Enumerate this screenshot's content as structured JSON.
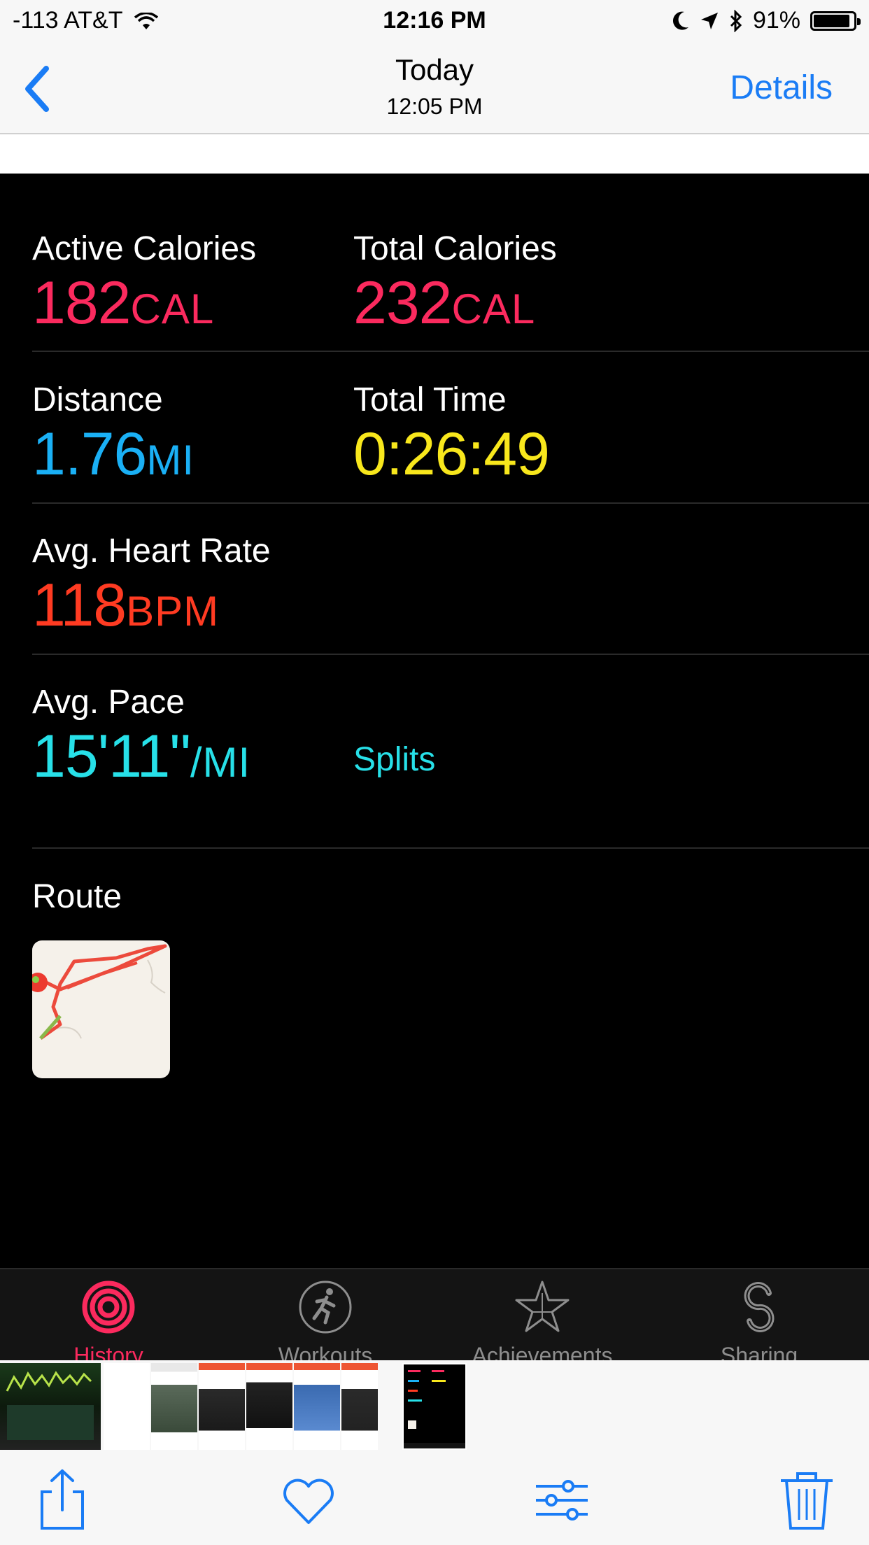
{
  "status_bar": {
    "carrier": "-113 AT&T",
    "time": "12:16 PM",
    "battery_percent": "91%",
    "battery_level": 0.91,
    "icons": [
      "wifi-icon",
      "moon-icon",
      "location-arrow-icon",
      "bluetooth-icon",
      "battery-icon"
    ]
  },
  "nav": {
    "title": "Today",
    "subtitle": "12:05 PM",
    "details_label": "Details"
  },
  "metrics": {
    "active_calories": {
      "label": "Active Calories",
      "value": "182",
      "unit": "CAL"
    },
    "total_calories": {
      "label": "Total Calories",
      "value": "232",
      "unit": "CAL"
    },
    "distance": {
      "label": "Distance",
      "value": "1.76",
      "unit": "MI"
    },
    "total_time": {
      "label": "Total Time",
      "value": "0:26:49"
    },
    "avg_heart_rate": {
      "label": "Avg. Heart Rate",
      "value": "118",
      "unit": "BPM"
    },
    "avg_pace": {
      "label": "Avg. Pace",
      "value": "15'11\"",
      "unit": "/MI"
    },
    "splits_label": "Splits"
  },
  "route": {
    "label": "Route"
  },
  "tabs": [
    {
      "label": "History",
      "icon": "activity-rings-icon",
      "active": true
    },
    {
      "label": "Workouts",
      "icon": "running-figure-icon",
      "active": false
    },
    {
      "label": "Achievements",
      "icon": "star-icon",
      "active": false
    },
    {
      "label": "Sharing",
      "icon": "sharing-icon",
      "active": false
    }
  ],
  "toolbar": {
    "icons": [
      "share-icon",
      "heart-icon",
      "adjust-icon",
      "trash-icon"
    ]
  },
  "colors": {
    "accent_blue": "#1a7cf5",
    "calories_pink": "#fb2a5e",
    "distance_blue": "#1ab0f5",
    "time_yellow": "#f8e71c",
    "heart_red": "#ff3b22",
    "pace_cyan": "#27e0e8"
  }
}
